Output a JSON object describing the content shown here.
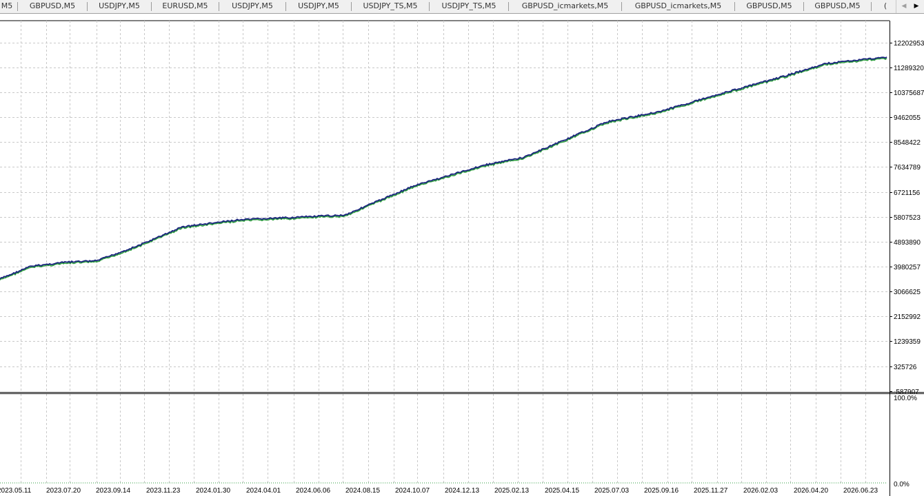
{
  "tabs": [
    {
      "label": "M5"
    },
    {
      "label": "GBPUSD,M5"
    },
    {
      "label": "USDJPY,M5"
    },
    {
      "label": "EURUSD,M5"
    },
    {
      "label": "USDJPY,M5"
    },
    {
      "label": "USDJPY,M5"
    },
    {
      "label": "USDJPY_TS,M5"
    },
    {
      "label": "USDJPY_TS,M5"
    },
    {
      "label": "GBPUSD_icmarkets,M5"
    },
    {
      "label": "GBPUSD_icmarkets,M5"
    },
    {
      "label": "GBPUSD,M5"
    },
    {
      "label": "GBPUSD,M5"
    },
    {
      "label": "("
    }
  ],
  "colors": {
    "balance_line": "#1a237e",
    "equity_line": "#2e9e3e",
    "grid": "#c8c8c8",
    "background": "#ffffff"
  },
  "chart_data": [
    {
      "type": "line",
      "name": "balance-equity-pane",
      "y_ticks": [
        "12202953",
        "11289320",
        "10375687",
        "9462055",
        "8548422",
        "7634789",
        "6721156",
        "5807523",
        "4893890",
        "3980257",
        "3066625",
        "2152992",
        "1239359",
        "325726",
        "-587907"
      ],
      "ylim": [
        -587907,
        12202953
      ],
      "x": [
        "2023.05.11",
        "2023.07.20",
        "2023.09.14",
        "2023.11.23",
        "2024.01.30",
        "2024.04.01",
        "2024.06.06",
        "2024.08.15",
        "2024.10.07",
        "2024.12.13",
        "2025.02.13",
        "2025.04.15",
        "2025.07.03",
        "2025.09.16",
        "2025.11.27",
        "2026.02.03",
        "2026.04.20",
        "2026.06.23"
      ],
      "series": [
        {
          "values": [
            3980257,
            4150000,
            4750000,
            5450000,
            5700000,
            5880000,
            6250000,
            6950000,
            7550000,
            8000000,
            8650000,
            9250000,
            9650000,
            10250000,
            10800000,
            10900000,
            11350000,
            11650000
          ]
        }
      ],
      "grid": true
    },
    {
      "type": "line",
      "name": "deposit-load-pane",
      "y_ticks": [
        "100.0%",
        "0.0%"
      ],
      "ylim": [
        0,
        100
      ],
      "x": [
        "2023.05.11",
        "2023.07.20",
        "2023.09.14",
        "2023.11.23",
        "2024.01.30",
        "2024.04.01",
        "2024.06.06",
        "2024.08.15",
        "2024.10.07",
        "2024.12.13",
        "2025.02.13",
        "2025.04.15",
        "2025.07.03",
        "2025.09.16",
        "2025.11.27",
        "2026.02.03",
        "2026.04.20",
        "2026.06.23"
      ],
      "x_tick_labels": [
        "2023.05.11",
        "2023.07.20",
        "2023.09.14",
        "2023.11.23",
        "2024.01.30",
        "2024.04.01",
        "2024.06.06",
        "2024.08.15",
        "2024.10.07",
        "2024.12.13",
        "2025.02.13",
        "2025.04.15",
        "2025.07.03",
        "2025.09.16",
        "2025.11.27",
        "2026.02.03",
        "2026.04.20",
        "2026.06.23"
      ],
      "series": [
        {
          "values": [
            0.3,
            0.3,
            0.3,
            0.3,
            0.3,
            0.3,
            0.3,
            0.3,
            0.3,
            0.3,
            0.3,
            0.3,
            0.3,
            0.3,
            0.3,
            0.3,
            0.3,
            0.3
          ]
        }
      ],
      "grid": true
    }
  ]
}
